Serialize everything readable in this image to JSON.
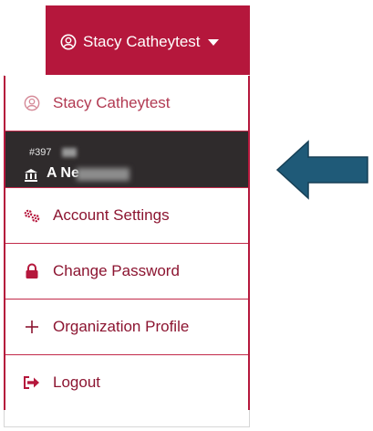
{
  "header": {
    "user_name": "Stacy Catheytest"
  },
  "menu": {
    "profile_label": "Stacy Catheytest",
    "account": {
      "number": "#397",
      "name": "A Ne"
    },
    "account_settings_label": "Account Settings",
    "change_password_label": "Change Password",
    "organization_profile_label": "Organization Profile",
    "logout_label": "Logout"
  },
  "colors": {
    "brand": "#b5173c",
    "active_row": "#2f2b2c",
    "arrow": "#1f5a78"
  },
  "icons": {
    "profile": "user-circle-icon",
    "account": "bank-icon",
    "settings": "gears-icon",
    "password": "lock-icon",
    "organization": "plus-icon",
    "logout": "sign-out-icon",
    "pointer": "arrow-left-icon"
  }
}
